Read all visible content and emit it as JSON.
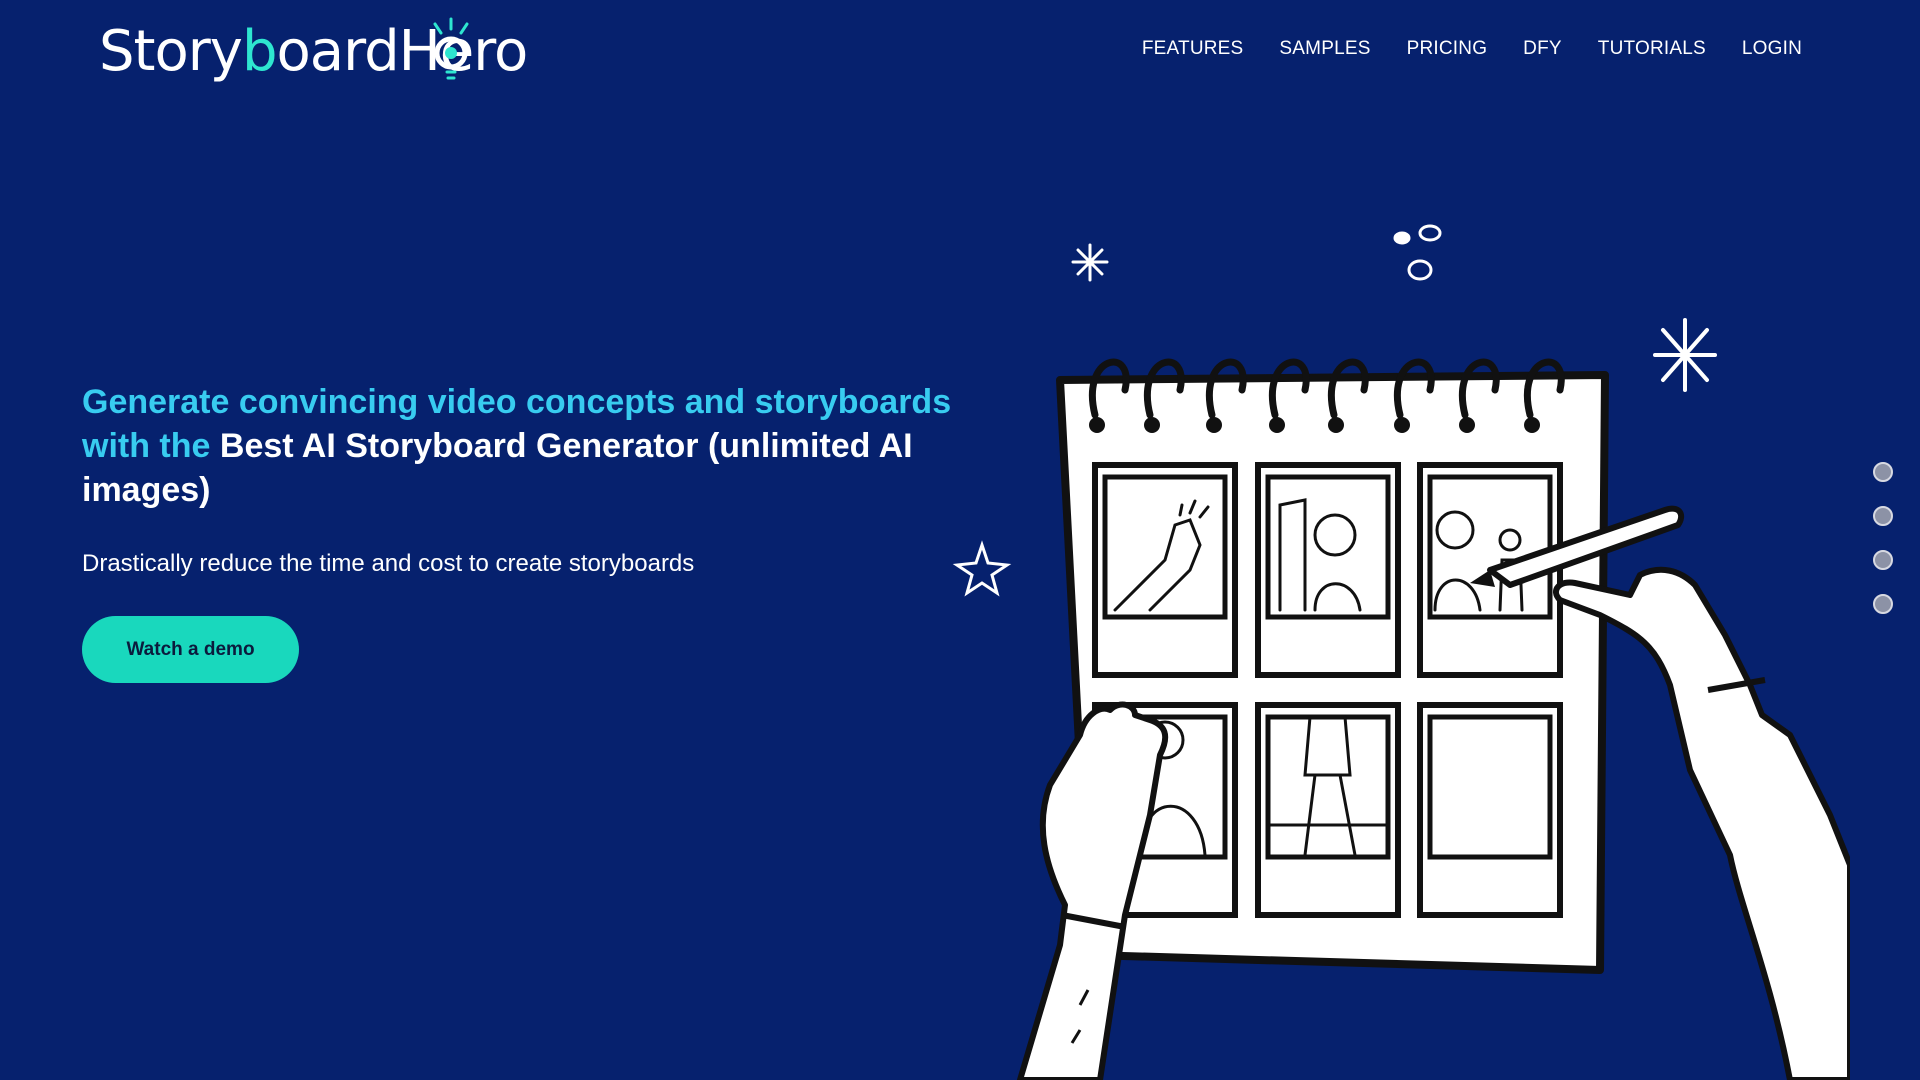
{
  "brand": {
    "logo_prefix": "Story",
    "logo_highlight": "b",
    "logo_suffix": "oardHero",
    "accent_color": "#2ee6d0",
    "background_color": "#06216e"
  },
  "nav": {
    "items": [
      {
        "label": "FEATURES"
      },
      {
        "label": "SAMPLES"
      },
      {
        "label": "PRICING"
      },
      {
        "label": "DFY"
      },
      {
        "label": "TUTORIALS"
      },
      {
        "label": "LOGIN"
      }
    ]
  },
  "hero": {
    "headline_part1": "Generate convincing video concepts and storyboards with the",
    "headline_part2": "Best AI Storyboard Generator (unlimited AI images)",
    "subheadline": "Drastically reduce the time and cost to create storyboards",
    "cta_label": "Watch a demo",
    "cta_color": "#19d8bd",
    "headline_accent_color": "#38ccf0"
  },
  "illustration": {
    "icon": "storyboard-sketch-illustration"
  },
  "slider": {
    "dot_count": 4
  }
}
